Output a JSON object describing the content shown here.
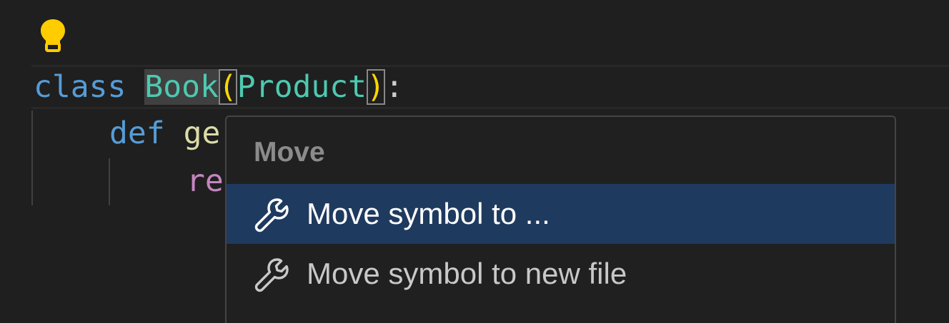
{
  "editor": {
    "lines": [
      {
        "tokens": [
          {
            "text": "class",
            "color": "#569cd6"
          },
          {
            "text": " ",
            "color": "#cccccc"
          },
          {
            "text": "Book",
            "color": "#4ec9b0"
          },
          {
            "text": "(",
            "color": "#ffd700"
          },
          {
            "text": "Product",
            "color": "#4ec9b0"
          },
          {
            "text": ")",
            "color": "#ffd700"
          },
          {
            "text": ":",
            "color": "#cccccc"
          }
        ]
      },
      {
        "tokens": [
          {
            "text": "def",
            "color": "#569cd6"
          },
          {
            "text": "ge",
            "color": "#dcdcaa"
          }
        ]
      },
      {
        "tokens": [
          {
            "text": "re",
            "color": "#c586c0"
          }
        ]
      }
    ],
    "lightbulb_icon": "lightbulb-icon",
    "lightbulb_color": "#ffcc00"
  },
  "code_action_menu": {
    "header": "Move",
    "items": [
      {
        "label": "Move symbol to ...",
        "icon": "wrench-icon",
        "selected": true
      },
      {
        "label": "Move symbol to new file",
        "icon": "wrench-icon",
        "selected": false
      }
    ],
    "selected_background": "#1f3a5f"
  }
}
